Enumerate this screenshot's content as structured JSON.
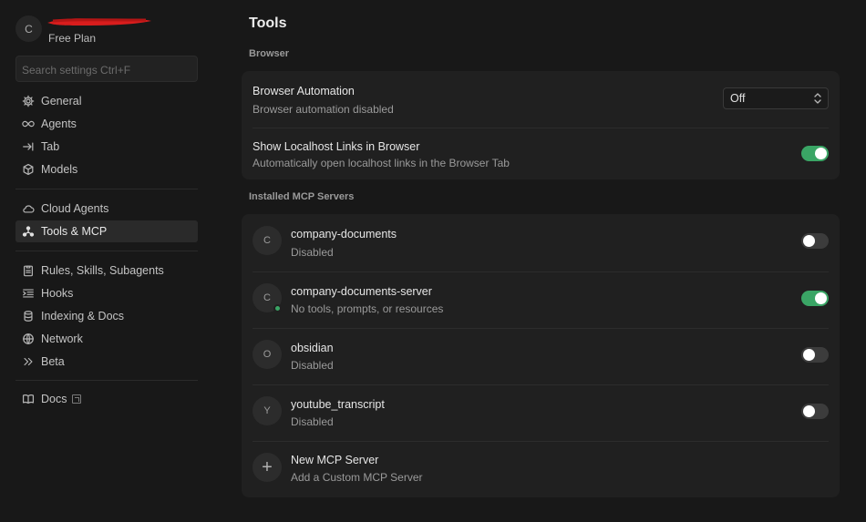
{
  "account": {
    "avatar_letter": "C",
    "plan": "Free Plan"
  },
  "search": {
    "placeholder": "Search settings Ctrl+F"
  },
  "sidebar": {
    "groups": [
      {
        "items": [
          {
            "label": "General",
            "icon": "gear-icon"
          },
          {
            "label": "Agents",
            "icon": "infinity-icon"
          },
          {
            "label": "Tab",
            "icon": "tab-arrow-icon"
          },
          {
            "label": "Models",
            "icon": "cube-icon"
          }
        ]
      },
      {
        "items": [
          {
            "label": "Cloud Agents",
            "icon": "cloud-icon"
          },
          {
            "label": "Tools & MCP",
            "icon": "nodes-icon",
            "active": true
          }
        ]
      },
      {
        "items": [
          {
            "label": "Rules, Skills, Subagents",
            "icon": "clipboard-icon"
          },
          {
            "label": "Hooks",
            "icon": "hooks-icon"
          },
          {
            "label": "Indexing & Docs",
            "icon": "database-icon"
          },
          {
            "label": "Network",
            "icon": "globe-icon"
          },
          {
            "label": "Beta",
            "icon": "double-chevron-icon"
          }
        ]
      },
      {
        "items": [
          {
            "label": "Docs",
            "icon": "book-icon",
            "external": true
          }
        ]
      }
    ]
  },
  "main": {
    "title": "Tools",
    "browser_section": {
      "title": "Browser",
      "automation": {
        "label": "Browser Automation",
        "description": "Browser automation disabled",
        "value": "Off"
      },
      "localhost": {
        "label": "Show Localhost Links in Browser",
        "description": "Automatically open localhost links in the Browser Tab",
        "enabled": true
      }
    },
    "mcp_section": {
      "title": "Installed MCP Servers",
      "servers": [
        {
          "letter": "C",
          "name": "company-documents",
          "status": "Disabled",
          "enabled": false,
          "running": false
        },
        {
          "letter": "C",
          "name": "company-documents-server",
          "status": "No tools, prompts, or resources",
          "enabled": true,
          "running": true
        },
        {
          "letter": "O",
          "name": "obsidian",
          "status": "Disabled",
          "enabled": false,
          "running": false
        },
        {
          "letter": "Y",
          "name": "youtube_transcript",
          "status": "Disabled",
          "enabled": false,
          "running": false
        }
      ],
      "new_server": {
        "icon": "plus-icon",
        "label": "New MCP Server",
        "description": "Add a Custom MCP Server"
      }
    }
  },
  "colors": {
    "toggle_on": "#3aa565",
    "status_running": "#3aa565",
    "redaction": "#e01e1e"
  }
}
